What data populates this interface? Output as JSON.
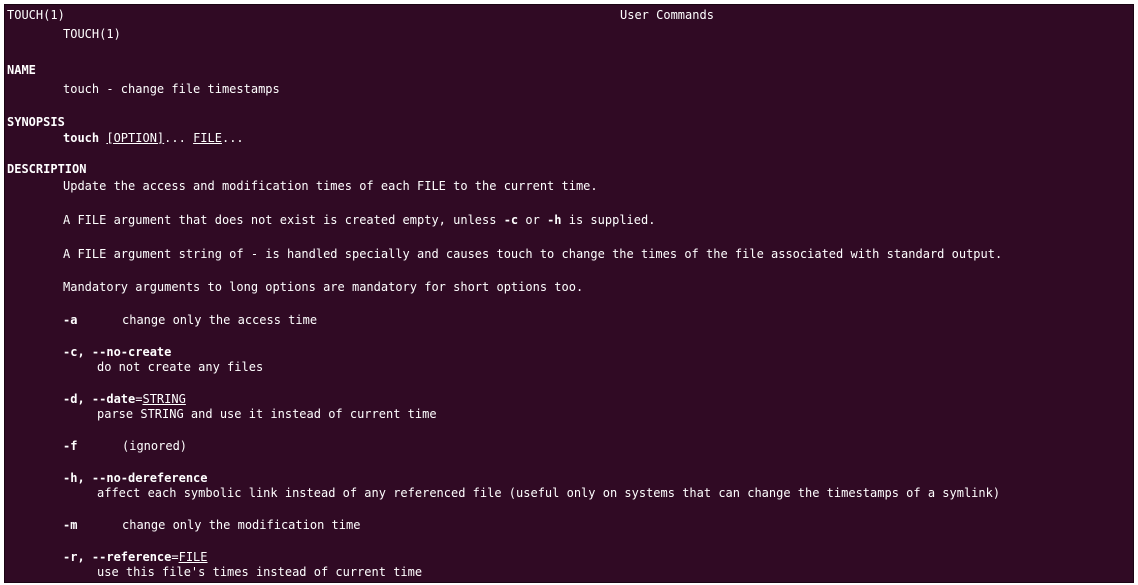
{
  "colors": {
    "terminal_bg": "#300a24",
    "text": "#ffffff"
  },
  "header": {
    "left": "TOUCH(1)",
    "center": "User Commands",
    "right": "TOUCH(1)"
  },
  "name": {
    "heading": "NAME",
    "text": "touch - change file timestamps"
  },
  "synopsis": {
    "heading": "SYNOPSIS",
    "command": "touch",
    "space": " ",
    "option_arg": "[OPTION]",
    "sep": "... ",
    "file_arg": "FILE",
    "end": "..."
  },
  "description": {
    "heading": "DESCRIPTION",
    "p1": "Update the access and modification times of each FILE to the current time.",
    "p2_a": "A FILE argument that does not exist is created empty, unless ",
    "p2_c": "-c",
    "p2_or": " or ",
    "p2_h": "-h",
    "p2_end": " is supplied.",
    "p3": "A FILE argument string of - is handled specially and causes touch to change the times of the file associated with standard output.",
    "p4": "Mandatory arguments to long options are mandatory for short options too."
  },
  "options": {
    "a_flag": "-a",
    "a_desc": "change only the access time",
    "c_flag": "-c, --no-create",
    "c_desc": "do not create any files",
    "d_flag": "-d, --date",
    "d_eq": "=",
    "d_arg": "STRING",
    "d_desc": "parse STRING and use it instead of current time",
    "f_flag": "-f",
    "f_desc": "(ignored)",
    "h_flag": "-h, --no-dereference",
    "h_desc": "affect each symbolic link instead of any referenced file (useful only on systems that can change the timestamps of a symlink)",
    "m_flag": "-m",
    "m_desc": "change only the modification time",
    "r_flag": "-r, --reference",
    "r_eq": "=",
    "r_arg": "FILE",
    "r_desc": "use this file's times instead of current time"
  }
}
